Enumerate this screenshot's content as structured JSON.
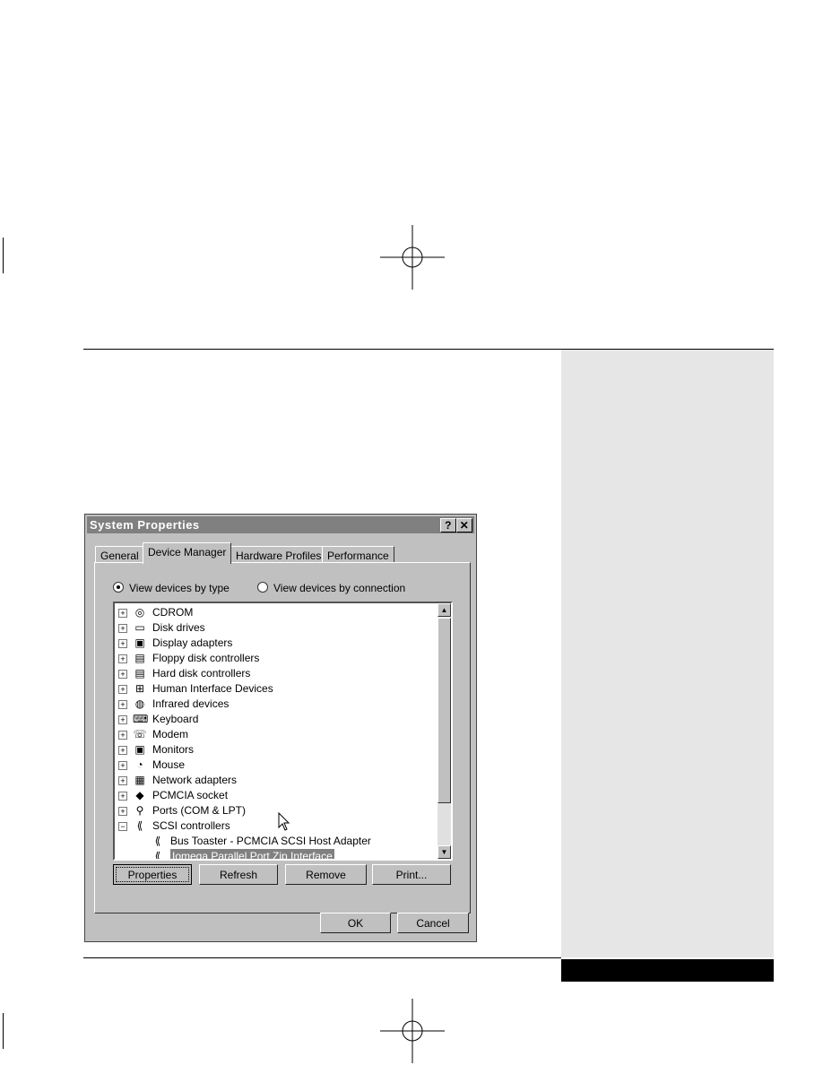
{
  "dialog": {
    "title": "System Properties",
    "help_button": "?",
    "close_button": "✕",
    "tabs": [
      {
        "label": "General"
      },
      {
        "label": "Device Manager",
        "active": true
      },
      {
        "label": "Hardware Profiles"
      },
      {
        "label": "Performance"
      }
    ],
    "view_by_type": "View devices by type",
    "view_by_connection": "View devices by connection",
    "selected_view": "type",
    "devices": [
      {
        "label": "CDROM",
        "icon": "cdrom-icon",
        "expander": "+"
      },
      {
        "label": "Disk drives",
        "icon": "disk-drive-icon",
        "expander": "+"
      },
      {
        "label": "Display adapters",
        "icon": "display-icon",
        "expander": "+"
      },
      {
        "label": "Floppy disk controllers",
        "icon": "floppy-controller-icon",
        "expander": "+"
      },
      {
        "label": "Hard disk controllers",
        "icon": "hard-disk-controller-icon",
        "expander": "+"
      },
      {
        "label": "Human Interface Devices",
        "icon": "hid-icon",
        "expander": "+"
      },
      {
        "label": "Infrared devices",
        "icon": "infrared-icon",
        "expander": "+"
      },
      {
        "label": "Keyboard",
        "icon": "keyboard-icon",
        "expander": "+"
      },
      {
        "label": "Modem",
        "icon": "modem-icon",
        "expander": "+"
      },
      {
        "label": "Monitors",
        "icon": "monitor-icon",
        "expander": "+"
      },
      {
        "label": "Mouse",
        "icon": "mouse-icon",
        "expander": "+"
      },
      {
        "label": "Network adapters",
        "icon": "network-adapter-icon",
        "expander": "+"
      },
      {
        "label": "PCMCIA socket",
        "icon": "pcmcia-icon",
        "expander": "+"
      },
      {
        "label": "Ports (COM & LPT)",
        "icon": "port-icon",
        "expander": "+"
      },
      {
        "label": "SCSI controllers",
        "icon": "scsi-icon",
        "expander": "−"
      }
    ],
    "children": [
      {
        "label": "Bus Toaster - PCMCIA SCSI Host Adapter",
        "icon": "scsi-icon"
      },
      {
        "label": "Iomega Parallel Port Zip Interface",
        "icon": "scsi-icon",
        "selected": true
      }
    ],
    "buttons": {
      "properties": "Properties",
      "refresh": "Refresh",
      "remove": "Remove",
      "print": "Print...",
      "ok": "OK",
      "cancel": "Cancel"
    }
  },
  "colors": {
    "sidebar": "#e6e6e6",
    "dialog_face": "#c0c0c0",
    "title_bar": "#808080",
    "selection": "#808080"
  }
}
